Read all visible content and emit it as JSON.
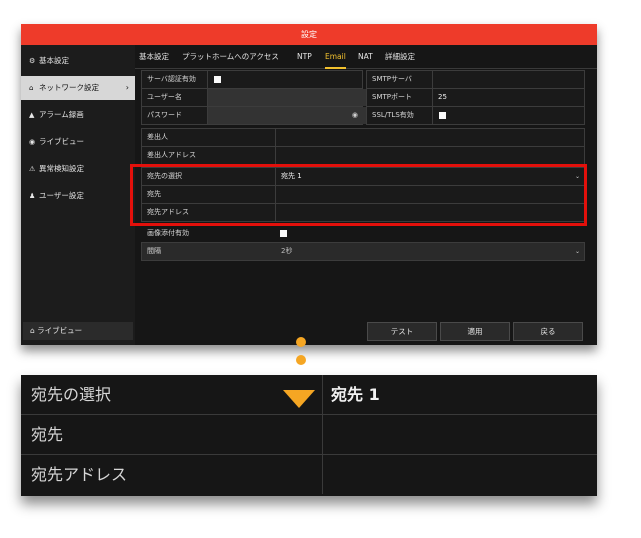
{
  "window": {
    "title": "設定"
  },
  "sidebar": {
    "items": [
      {
        "label": "基本設定",
        "icon": "gear-icon"
      },
      {
        "label": "ネットワーク設定",
        "icon": "network-icon",
        "active": true
      },
      {
        "label": "アラーム録画",
        "icon": "bell-icon"
      },
      {
        "label": "ライブビュー",
        "icon": "eye-icon"
      },
      {
        "label": "異常検知設定",
        "icon": "warning-icon"
      },
      {
        "label": "ユーザー設定",
        "icon": "users-icon"
      }
    ],
    "bottom_button": "ライブビュー",
    "active_arrow": "›"
  },
  "tabs": [
    "基本設定",
    "プラットホームへのアクセス",
    "NTP",
    "Email",
    "NAT",
    "詳細設定"
  ],
  "active_tab": "Email",
  "form": {
    "server_auth_label": "サーバ認証有効",
    "username_label": "ユーザー名",
    "password_label": "パスワード",
    "smtp_server_label": "SMTPサーバ",
    "smtp_port_label": "SMTPポート",
    "smtp_port_value": "25",
    "ssl_label": "SSL/TLS有効",
    "sender_label": "差出人",
    "sender_address_label": "差出人アドレス",
    "recipient_select_label": "宛先の選択",
    "recipient_select_value": "宛先 1",
    "recipient_label": "宛先",
    "recipient_address_label": "宛先アドレス",
    "attach_image_label": "画像添付有効",
    "interval_label": "間隔",
    "interval_value": "2秒"
  },
  "buttons": {
    "test": "テスト",
    "apply": "適用",
    "back": "戻る"
  },
  "zoom": {
    "rows": [
      {
        "label": "宛先の選択",
        "value": "宛先 1"
      },
      {
        "label": "宛先",
        "value": ""
      },
      {
        "label": "宛先アドレス",
        "value": ""
      }
    ]
  },
  "colors": {
    "title_bar": "#ee3b2a",
    "highlight": "#e3100b",
    "connector": "#f5a623",
    "active_tab": "#f2c12e"
  }
}
